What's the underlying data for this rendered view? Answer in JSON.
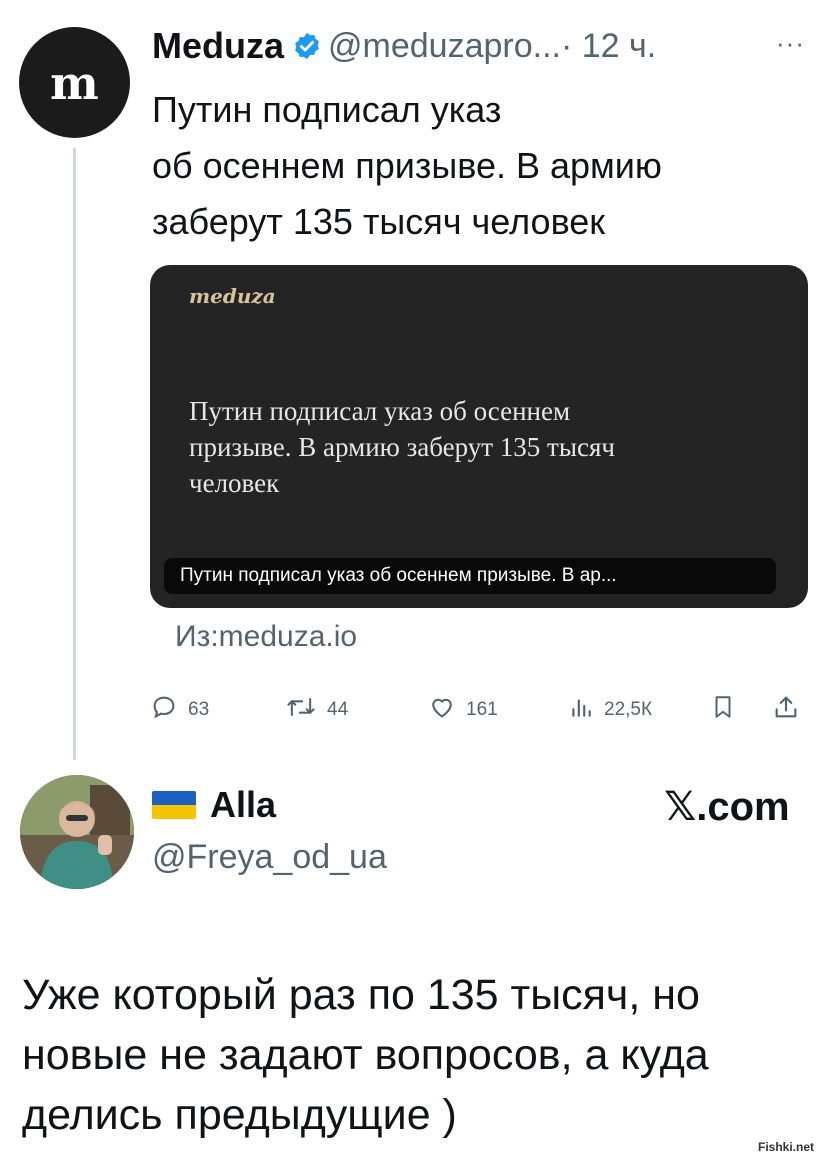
{
  "quoted_tweet": {
    "avatar_letter": "m",
    "author_name": "Meduza",
    "handle": "@meduzapro...",
    "time": "· 12 ч.",
    "more": "···",
    "text_lines": [
      "Путин подписал указ",
      "об осеннем призыве. В армию",
      "заберут 135 тысяч человек"
    ],
    "card": {
      "logo": "meduza",
      "headline_lines": [
        "Путин подписал указ об осеннем",
        "призыве. В армию заберут 135 тысяч",
        "человек"
      ],
      "caption": "Путин подписал указ об осеннем призыве. В ар..."
    },
    "source": "Из:meduza.io",
    "actions": {
      "replies": "63",
      "retweets": "44",
      "likes": "161",
      "views": "22,5К"
    }
  },
  "main_tweet": {
    "author_name": "Alla",
    "handle": "@Freya_od_ua",
    "brand": "𝕏.com",
    "text_lines": [
      "Уже который раз по 135 тысяч, но",
      "новые не задают вопросов, а куда",
      "делись предыдущие )"
    ]
  },
  "watermark": "Fishki.net",
  "colors": {
    "verified": "#1d9bf0",
    "secondary_text": "#536471",
    "card_bg": "#242424",
    "flag_blue": "#1d5fc2",
    "flag_yellow": "#f5c400"
  }
}
